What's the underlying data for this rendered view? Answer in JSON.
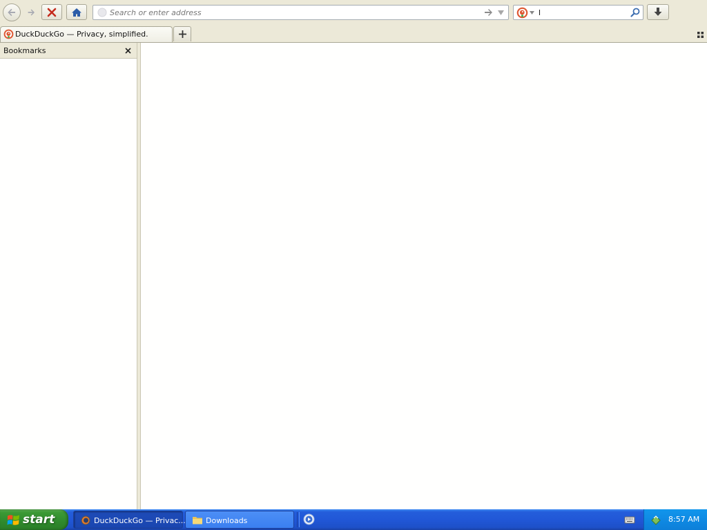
{
  "browser": {
    "toolbar": {
      "address_placeholder": "Search or enter address",
      "search_value": "l",
      "search_engine_icon": "duckduckgo-icon"
    },
    "tab": {
      "title": "DuckDuckGo — Privacy, simplified.",
      "icon": "duckduckgo-icon"
    },
    "sidebar": {
      "title": "Bookmarks"
    }
  },
  "taskbar": {
    "start_label": "start",
    "tasks": [
      {
        "label": "DuckDuckGo — Privac...",
        "icon": "firefox-icon",
        "active": true
      },
      {
        "label": "Downloads",
        "icon": "folder-icon",
        "active": false
      }
    ],
    "clock": "8:57 AM"
  },
  "colors": {
    "chrome_bg": "#ece9d8",
    "taskbar_blue": "#245edb",
    "start_green": "#3c9a35",
    "tray_blue": "#0f8ae3",
    "stop_red": "#c42b1c",
    "home_blue": "#2b5ca8"
  }
}
